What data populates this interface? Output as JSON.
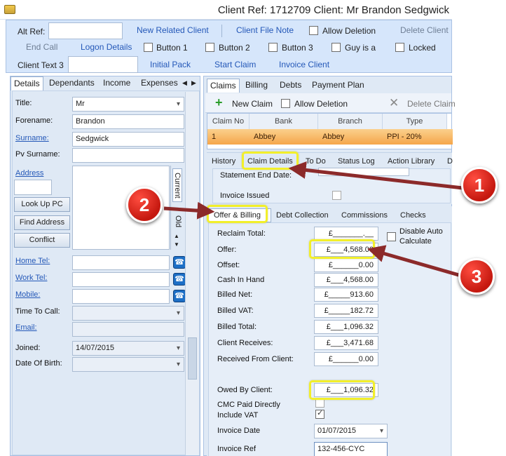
{
  "window": {
    "title": "Client Ref: 1712709 Client: Mr Brandon Sedgwick"
  },
  "ribbon": {
    "alt_ref_label": "Alt Ref:",
    "new_related_client": "New Related Client",
    "client_file_note": "Client File Note",
    "allow_deletion": "Allow Deletion",
    "delete_client": "Delete Client",
    "end_call": "End Call",
    "logon_details": "Logon Details",
    "button1": "Button 1",
    "button2": "Button 2",
    "button3": "Button 3",
    "guy_is_a": "Guy is a",
    "locked": "Locked",
    "client_text3_label": "Client Text 3",
    "initial_pack": "Initial Pack",
    "start_claim": "Start Claim",
    "invoice_client": "Invoice Client"
  },
  "left": {
    "tabs": [
      "Details",
      "Dependants",
      "Income",
      "Expenses"
    ],
    "title_label": "Title:",
    "title_value": "Mr",
    "forename_label": "Forename:",
    "forename_value": "Brandon",
    "surname_label": "Surname:",
    "surname_value": "Sedgwick",
    "pv_surname_label": "Pv Surname:",
    "address_label": "Address",
    "look_up_pc": "Look Up PC",
    "find_address": "Find Address",
    "conflict": "Conflict",
    "address_tabs": [
      "Current",
      "Old"
    ],
    "home_tel": "Home Tel:",
    "work_tel": "Work Tel:",
    "mobile": "Mobile:",
    "time_to_call": "Time To Call:",
    "email": "Email:",
    "joined_label": "Joined:",
    "joined_value": "14/07/2015",
    "dob_label": "Date Of Birth:"
  },
  "claims": {
    "tabs": [
      "Claims",
      "Billing",
      "Debts",
      "Payment Plan"
    ],
    "new_claim": "New Claim",
    "allow_deletion": "Allow Deletion",
    "delete_claim": "Delete Claim",
    "columns": [
      "Claim No",
      "Bank",
      "Branch",
      "Type"
    ],
    "row": {
      "claim_no": "1",
      "bank": "Abbey",
      "branch": "Abbey",
      "type": "PPI - 20%"
    }
  },
  "detail": {
    "tabs": [
      "History",
      "Claim Details",
      "To Do",
      "Status Log",
      "Action Library",
      "D"
    ],
    "statement_end_date": "Statement End Date:",
    "invoice_issued": "Invoice Issued"
  },
  "offer": {
    "tabs": [
      "Offer & Billing",
      "Debt Collection",
      "Commissions",
      "Checks"
    ],
    "disable_auto": "Disable Auto",
    "calculate": "Calculate",
    "fields": [
      {
        "label": "Reclaim Total:",
        "value": "£_______.__"
      },
      {
        "label": "Offer:",
        "value": "£___4,568.00"
      },
      {
        "label": "Offset:",
        "value": "£______0.00"
      },
      {
        "label": "Cash In Hand",
        "value": "£___4,568.00"
      },
      {
        "label": "Billed Net:",
        "value": "£_____913.60"
      },
      {
        "label": "Billed VAT:",
        "value": "£_____182.72"
      },
      {
        "label": "Billed Total:",
        "value": "£___1,096.32"
      },
      {
        "label": "Client Receives:",
        "value": "£___3,471.68"
      },
      {
        "label": "Received From Client:",
        "value": "£______0.00"
      }
    ],
    "owed_label": "Owed By Client:",
    "owed_value": "£___1,096.32",
    "cmc_paid": "CMC Paid Directly",
    "include_vat": "Include VAT",
    "invoice_date_label": "Invoice Date",
    "invoice_date_value": "01/07/2015",
    "invoice_ref_label": "Invoice Ref",
    "invoice_ref_value": "132-456-CYC"
  },
  "callouts": [
    "1",
    "2",
    "3"
  ],
  "colors": {
    "highlight": "#f2ef2a",
    "badge": "#d9201a",
    "arrow": "#8c2a2a",
    "selected_row": "#f7b25a"
  }
}
